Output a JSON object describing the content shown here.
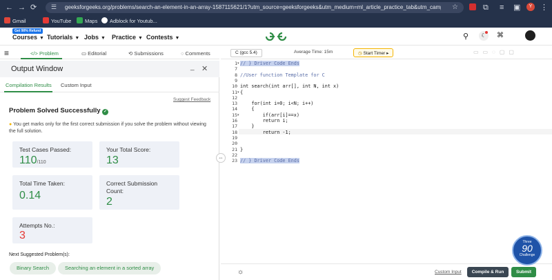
{
  "browser": {
    "url": "geeksforgeeks.org/problems/search-an-element-in-an-array-1587115621/1?utm_source=geeksforgeeks&utm_medium=ml_article_practice_tab&utm_campaign=article_practic...",
    "bookmarks": [
      "Gmail",
      "YouTube",
      "Maps",
      "Adblock for Youtub..."
    ],
    "profile_initial": "Y",
    "icons": [
      "back-icon",
      "forward-icon",
      "reload-icon",
      "star-icon"
    ]
  },
  "nav": {
    "badge": "Get 90% Refund",
    "items": [
      "Courses",
      "Tutorials",
      "Jobs",
      "Practice",
      "Contests"
    ],
    "logo": "GfG"
  },
  "tabs": [
    "Problem",
    "Editorial",
    "Submissions",
    "Comments"
  ],
  "output": {
    "title": "Output Window",
    "subtabs": [
      "Compilation Results",
      "Custom Input"
    ],
    "suggest": "Suggest Feedback",
    "status": "Problem Solved Successfully",
    "note": "You get marks only for the first correct submission if you solve the problem without viewing the full solution.",
    "cards": {
      "tests_label": "Test Cases Passed:",
      "tests_value": "110",
      "tests_total": "/110",
      "score_label": "Your Total Score:",
      "score_value": "13",
      "time_label": "Total Time Taken:",
      "time_value": "0.14",
      "subcount_label": "Correct Submission Count:",
      "subcount_value": "2",
      "attempts_label": "Attempts No.:",
      "attempts_value": "3"
    },
    "next_label": "Next Suggested Problem(s):",
    "suggestions": [
      "Binary Search",
      "Searching an element in a sorted array"
    ]
  },
  "editor": {
    "language": "C (gcc 5.4)",
    "avg_time": "Average Time: 15m",
    "timer": "Start Timer",
    "line_numbers": [
      "1",
      "7",
      "8",
      "9",
      "10",
      "11",
      "12",
      "13",
      "14",
      "15",
      "16",
      "17",
      "18",
      "19",
      "20",
      "21",
      "22",
      "23"
    ],
    "lines": [
      "// } Driver Code Ends",
      "//User function Template for C",
      "",
      "int search(int arr[], int N, int x)",
      "{",
      "",
      "    for(int i=0; i<N; i++)",
      "    {",
      "        if(arr[i]==x)",
      "        return i;",
      "    }",
      "        return -1;",
      "",
      "",
      "}",
      "",
      "// } Driver Code Ends"
    ]
  },
  "bottom": {
    "custom_input": "Custom Input",
    "compile": "Compile & Run",
    "submit": "Submit"
  },
  "seal": {
    "top": "Three",
    "num": "90",
    "bottom": "Challenge"
  }
}
